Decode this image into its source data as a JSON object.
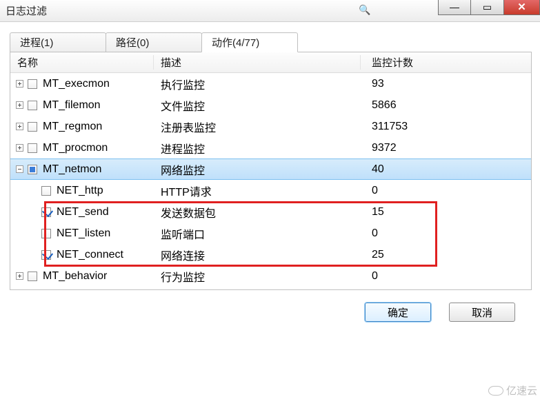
{
  "window": {
    "title": "日志过滤"
  },
  "tabs": {
    "process": "进程(1)",
    "path": "路径(0)",
    "action": "动作(4/77)"
  },
  "columns": {
    "name": "名称",
    "desc": "描述",
    "count": "监控计数"
  },
  "rows": {
    "execmon": {
      "name": "MT_execmon",
      "desc": "执行监控",
      "count": "93"
    },
    "filemon": {
      "name": "MT_filemon",
      "desc": "文件监控",
      "count": "5866"
    },
    "regmon": {
      "name": "MT_regmon",
      "desc": "注册表监控",
      "count": "311753"
    },
    "procmon": {
      "name": "MT_procmon",
      "desc": "进程监控",
      "count": "9372"
    },
    "netmon": {
      "name": "MT_netmon",
      "desc": "网络监控",
      "count": "40"
    },
    "nhttp": {
      "name": "NET_http",
      "desc": "HTTP请求",
      "count": "0"
    },
    "nsend": {
      "name": "NET_send",
      "desc": "发送数据包",
      "count": "15"
    },
    "nlisten": {
      "name": "NET_listen",
      "desc": "监听端口",
      "count": "0"
    },
    "nconnect": {
      "name": "NET_connect",
      "desc": "网络连接",
      "count": "25"
    },
    "behavior": {
      "name": "MT_behavior",
      "desc": "行为监控",
      "count": "0"
    }
  },
  "buttons": {
    "ok": "确定",
    "cancel": "取消"
  },
  "watermark": "亿速云"
}
